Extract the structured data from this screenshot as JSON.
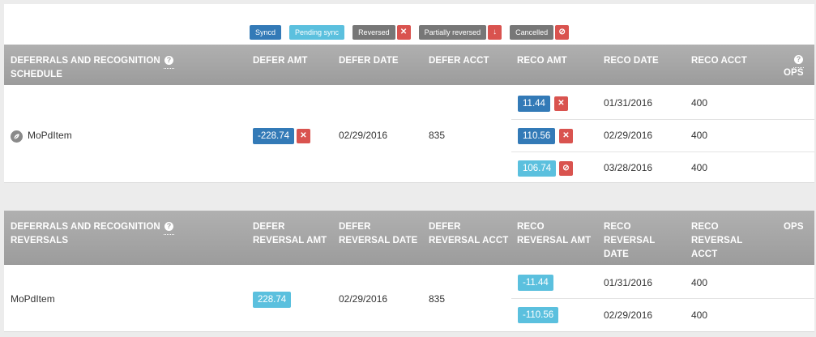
{
  "legend": {
    "synced": "Syncd",
    "pending": "Pending sync",
    "reversed": "Reversed",
    "partially_reversed": "Partially reversed",
    "cancelled": "Cancelled",
    "icons": {
      "reversed": "x-icon",
      "partially_reversed": "down-arrow-icon",
      "cancelled": "ban-icon"
    },
    "colors": {
      "synced": "#337ab7",
      "pending": "#5bc0de",
      "gray": "#777777",
      "danger": "#d9534f"
    }
  },
  "schedule": {
    "headers": {
      "title": "DEFERRALS AND RECOGNITION SCHEDULE",
      "defer_amt": "DEFER AMT",
      "defer_date": "DEFER DATE",
      "defer_acct": "DEFER ACCT",
      "reco_amt": "RECO AMT",
      "reco_date": "RECO DATE",
      "reco_acct": "RECO ACCT",
      "ops": "OPS"
    },
    "item": "MoPdItem",
    "defer_amt": "-228.74",
    "defer_date": "02/29/2016",
    "defer_acct": "835",
    "reco": [
      {
        "amt": "11.44",
        "date": "01/31/2016",
        "acct": "400",
        "status": "synced",
        "action_icon": "x-icon"
      },
      {
        "amt": "110.56",
        "date": "02/29/2016",
        "acct": "400",
        "status": "synced",
        "action_icon": "x-icon"
      },
      {
        "amt": "106.74",
        "date": "03/28/2016",
        "acct": "400",
        "status": "pending",
        "action_icon": "ban-icon"
      }
    ]
  },
  "reversals": {
    "headers": {
      "title": "DEFERRALS AND RECOGNITION REVERSALS",
      "defer_amt": "DEFER REVERSAL AMT",
      "defer_date": "DEFER REVERSAL DATE",
      "defer_acct": "DEFER REVERSAL ACCT",
      "reco_amt": "RECO REVERSAL AMT",
      "reco_date": "RECO REVERSAL DATE",
      "reco_acct": "RECO REVERSAL ACCT",
      "ops": "OPS"
    },
    "item": "MoPdItem",
    "defer_amt": "228.74",
    "defer_date": "02/29/2016",
    "defer_acct": "835",
    "reco": [
      {
        "amt": "-11.44",
        "date": "01/31/2016",
        "acct": "400"
      },
      {
        "amt": "-110.56",
        "date": "02/29/2016",
        "acct": "400"
      }
    ]
  }
}
